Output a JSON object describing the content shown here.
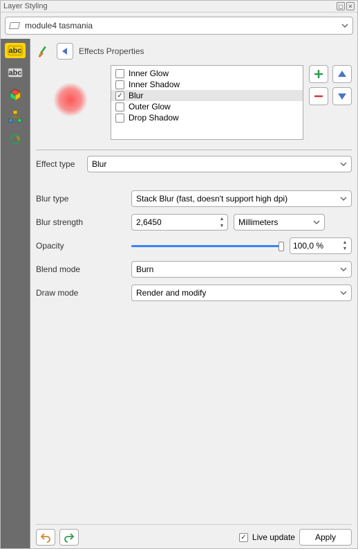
{
  "panel_title": "Layer Styling",
  "layer_name": "module4 tasmania",
  "header": {
    "title": "Effects Properties"
  },
  "effects": [
    {
      "label": "Inner Glow",
      "checked": false
    },
    {
      "label": "Inner Shadow",
      "checked": false
    },
    {
      "label": "Blur",
      "checked": true,
      "selected": true
    },
    {
      "label": "Outer Glow",
      "checked": false
    },
    {
      "label": "Drop Shadow",
      "checked": false
    }
  ],
  "effect_type": {
    "label": "Effect type",
    "value": "Blur"
  },
  "blur_type": {
    "label": "Blur type",
    "value": "Stack Blur (fast, doesn't support high dpi)"
  },
  "blur_strength": {
    "label": "Blur strength",
    "value": "2,6450",
    "unit": "Millimeters"
  },
  "opacity": {
    "label": "Opacity",
    "percent": 100,
    "display": "100,0 %"
  },
  "blend_mode": {
    "label": "Blend mode",
    "value": "Burn"
  },
  "draw_mode": {
    "label": "Draw mode",
    "value": "Render and modify"
  },
  "footer": {
    "live_update": "Live update",
    "apply": "Apply"
  }
}
